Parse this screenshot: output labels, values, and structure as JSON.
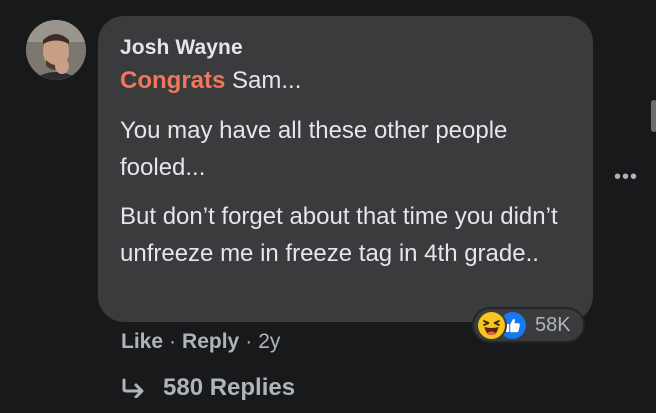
{
  "comment": {
    "author": "Josh Wayne",
    "mention": "Congrats",
    "first_line_rest": " Sam...",
    "paragraph_1": "You may have all these other people fooled...",
    "paragraph_2": "But don’t forget about that time you didn’t unfreeze me in freeze tag in 4th grade..",
    "reaction_count": "58K",
    "reaction_icons": [
      "haha-emoji-icon",
      "like-thumb-icon"
    ]
  },
  "actions": {
    "like_label": "Like",
    "reply_label": "Reply",
    "separator": "·",
    "age": "2y"
  },
  "replies": {
    "label": "580 Replies"
  },
  "colors": {
    "background": "#18191a",
    "bubble": "#3a3b3c",
    "mention": "#f0765c",
    "primary_text": "#e4e6eb",
    "secondary_text": "#b0b3b8",
    "like_blue": "#1877f2",
    "haha_yellow": "#f7c51e"
  }
}
